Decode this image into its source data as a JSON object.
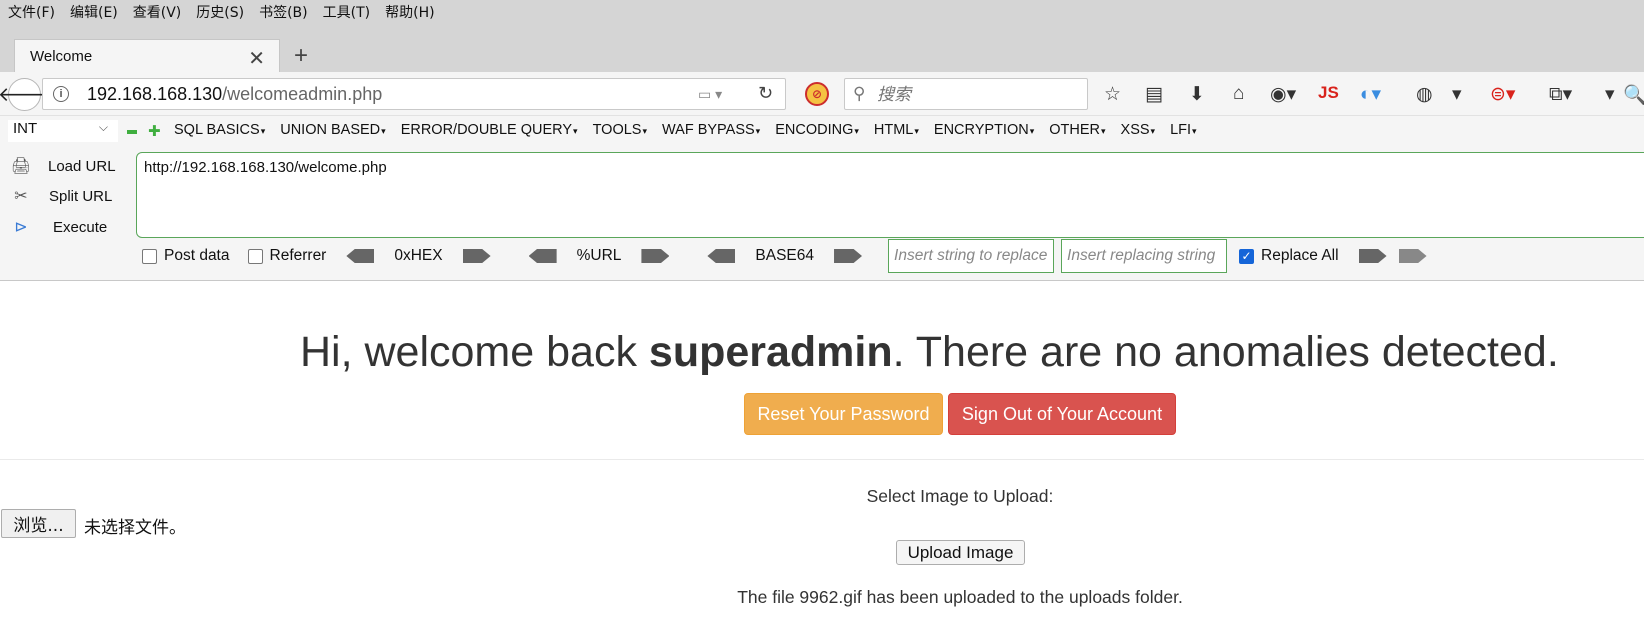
{
  "menubar": {
    "items": [
      "文件(F)",
      "编辑(E)",
      "查看(V)",
      "历史(S)",
      "书签(B)",
      "工具(T)",
      "帮助(H)"
    ]
  },
  "tab": {
    "title": "Welcome"
  },
  "navbar": {
    "url_host": "192.168.168.130",
    "url_path": "/welcomeadmin.php",
    "search_placeholder": "搜索",
    "js_badge": "JS"
  },
  "hackbar": {
    "select_value": "INT",
    "menus": [
      "SQL BASICS",
      "UNION BASED",
      "ERROR/DOUBLE QUERY",
      "TOOLS",
      "WAF BYPASS",
      "ENCODING",
      "HTML",
      "ENCRYPTION",
      "OTHER",
      "XSS",
      "LFI"
    ],
    "load_url": "Load URL",
    "split_url": "Split URL",
    "execute": "Execute",
    "url_value": "http://192.168.168.130/welcome.php",
    "post_data": "Post data",
    "referrer": "Referrer",
    "hex": "0xHEX",
    "url_enc": "%URL",
    "base64": "BASE64",
    "find_placeholder": "Insert string to replace",
    "replace_placeholder": "Insert replacing string",
    "replace_all": "Replace All",
    "replace_all_checked": true
  },
  "page": {
    "greeting_pre": "Hi, welcome back ",
    "username": "superadmin",
    "greeting_post": ". There are no anomalies detected.",
    "reset_label": "Reset Your Password",
    "signout_label": "Sign Out of Your Account",
    "select_label": "Select Image to Upload:",
    "browse_label": "浏览...",
    "no_file_label": "未选择文件。",
    "upload_label": "Upload Image",
    "upload_message": "The file 9962.gif has been uploaded to the uploads folder."
  },
  "colors": {
    "warning": "#f0ad4e",
    "danger": "#d9534f",
    "hackbar_green": "#5aa65a",
    "checkbox_blue": "#1565d8"
  }
}
